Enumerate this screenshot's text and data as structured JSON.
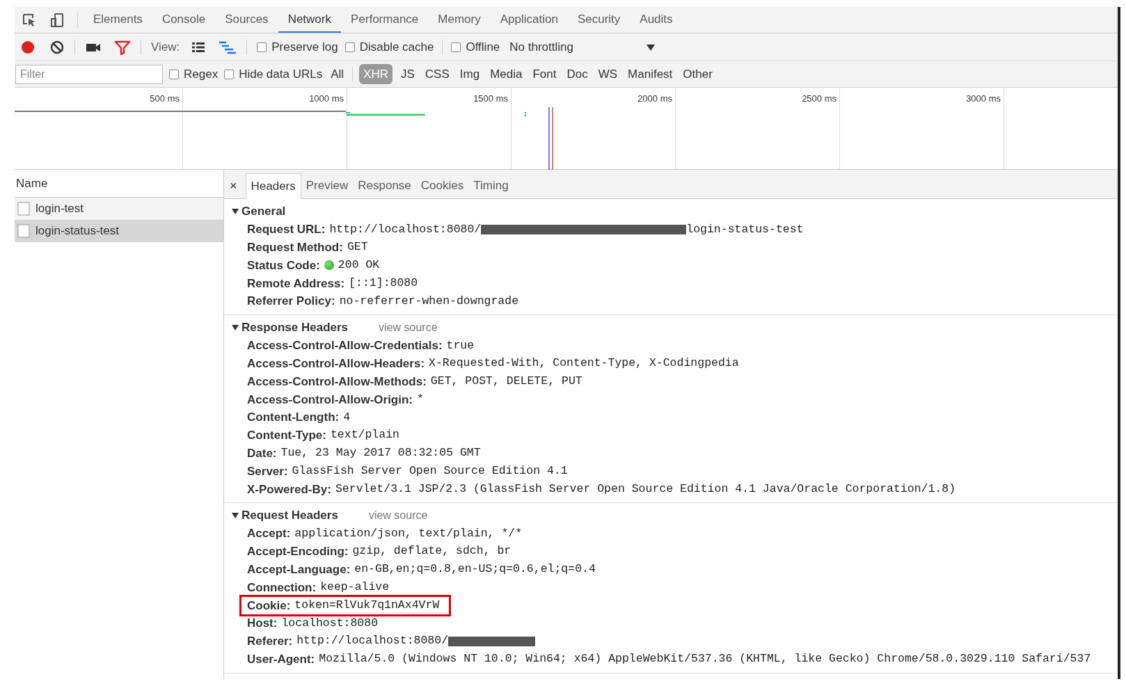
{
  "main_tabs": [
    {
      "label": "Elements",
      "selected": false
    },
    {
      "label": "Console",
      "selected": false
    },
    {
      "label": "Sources",
      "selected": false
    },
    {
      "label": "Network",
      "selected": true
    },
    {
      "label": "Performance",
      "selected": false
    },
    {
      "label": "Memory",
      "selected": false
    },
    {
      "label": "Application",
      "selected": false
    },
    {
      "label": "Security",
      "selected": false
    },
    {
      "label": "Audits",
      "selected": false
    }
  ],
  "toolbar": {
    "recording": true,
    "filter_active": true,
    "view_label": "View:",
    "checkboxes": [
      {
        "label": "Preserve log",
        "checked": false
      },
      {
        "label": "Disable cache",
        "checked": false
      },
      {
        "label": "Offline",
        "checked": false
      }
    ],
    "throttling": "No throttling"
  },
  "filter_bar": {
    "placeholder": "Filter",
    "checkboxes": [
      {
        "label": "Regex",
        "checked": false
      },
      {
        "label": "Hide data URLs",
        "checked": false
      }
    ],
    "types": [
      {
        "label": "All",
        "selected": false
      },
      {
        "label": "XHR",
        "selected": true
      },
      {
        "label": "JS",
        "selected": false
      },
      {
        "label": "CSS",
        "selected": false
      },
      {
        "label": "Img",
        "selected": false
      },
      {
        "label": "Media",
        "selected": false
      },
      {
        "label": "Font",
        "selected": false
      },
      {
        "label": "Doc",
        "selected": false
      },
      {
        "label": "WS",
        "selected": false
      },
      {
        "label": "Manifest",
        "selected": false
      },
      {
        "label": "Other",
        "selected": false
      }
    ]
  },
  "timeline": {
    "ticks": [
      "500 ms",
      "1000 ms",
      "1500 ms",
      "2000 ms",
      "2500 ms",
      "3000 ms"
    ]
  },
  "requests": {
    "column": "Name",
    "items": [
      {
        "name": "login-test",
        "selected": false
      },
      {
        "name": "login-status-test",
        "selected": true
      }
    ]
  },
  "detail_tabs": {
    "close": "×",
    "tabs": [
      {
        "label": "Headers",
        "selected": true
      },
      {
        "label": "Preview",
        "selected": false
      },
      {
        "label": "Response",
        "selected": false
      },
      {
        "label": "Cookies",
        "selected": false
      },
      {
        "label": "Timing",
        "selected": false
      }
    ]
  },
  "sections": [
    {
      "title": "General",
      "expanded": true,
      "rows": [
        {
          "kind": "text",
          "name": "Request URL:",
          "value": "http://localhost:8080/",
          "redacted": true,
          "value_tail": "login-status-test"
        },
        {
          "kind": "text",
          "name": "Request Method:",
          "value": "GET",
          "redacted": false
        },
        {
          "kind": "status",
          "name": "Status Code:",
          "value": "200 OK",
          "redacted": false
        },
        {
          "kind": "text",
          "name": "Remote Address:",
          "value": "[::1]:8080",
          "redacted": false
        },
        {
          "kind": "text",
          "name": "Referrer Policy:",
          "value": "no-referrer-when-downgrade",
          "redacted": false
        }
      ]
    },
    {
      "title": "Response Headers",
      "link": "view source",
      "expanded": true,
      "rows": [
        {
          "kind": "text",
          "name": "Access-Control-Allow-Credentials:",
          "value": "true",
          "redacted": false
        },
        {
          "kind": "text",
          "name": "Access-Control-Allow-Headers:",
          "value": "X-Requested-With, Content-Type, X-Codingpedia",
          "redacted": false
        },
        {
          "kind": "text",
          "name": "Access-Control-Allow-Methods:",
          "value": "GET, POST, DELETE, PUT",
          "redacted": false
        },
        {
          "kind": "text",
          "name": "Access-Control-Allow-Origin:",
          "value": "*",
          "redacted": false
        },
        {
          "kind": "text",
          "name": "Content-Length:",
          "value": "4",
          "redacted": false
        },
        {
          "kind": "text",
          "name": "Content-Type:",
          "value": "text/plain",
          "redacted": false
        },
        {
          "kind": "text",
          "name": "Date:",
          "value": "Tue, 23 May 2017 08:32:05 GMT",
          "redacted": false
        },
        {
          "kind": "text",
          "name": "Server:",
          "value": "GlassFish Server Open Source Edition  4.1",
          "redacted": false
        },
        {
          "kind": "text",
          "name": "X-Powered-By:",
          "value": "Servlet/3.1 JSP/2.3 (GlassFish Server Open Source Edition  4.1  Java/Oracle Corporation/1.8)",
          "redacted": false
        }
      ]
    },
    {
      "title": "Request Headers",
      "link": "view source",
      "expanded": true,
      "rows": [
        {
          "kind": "text",
          "name": "Accept:",
          "value": "application/json, text/plain, */*",
          "redacted": false,
          "highlighted": false
        },
        {
          "kind": "text",
          "name": "Accept-Encoding:",
          "value": "gzip, deflate, sdch, br",
          "redacted": false,
          "highlighted": false
        },
        {
          "kind": "text",
          "name": "Accept-Language:",
          "value": "en-GB,en;q=0.8,en-US;q=0.6,el;q=0.4",
          "redacted": false,
          "highlighted": false
        },
        {
          "kind": "text",
          "name": "Connection:",
          "value": "keep-alive",
          "redacted": false,
          "highlighted": false
        },
        {
          "kind": "text",
          "name": "Cookie:",
          "value": "token=RlVuk7q1nAx4VrW",
          "redacted": false,
          "highlighted": true
        },
        {
          "kind": "text",
          "name": "Host:",
          "value": "localhost:8080",
          "redacted": false,
          "highlighted": false
        },
        {
          "kind": "text",
          "name": "Referer:",
          "value": "http://localhost:8080/",
          "redacted": true,
          "highlighted": false
        },
        {
          "kind": "text",
          "name": "User-Agent:",
          "value": "Mozilla/5.0 (Windows NT 10.0; Win64; x64) AppleWebKit/537.36 (KHTML, like Gecko) Chrome/58.0.3029.110 Safari/537",
          "redacted": false,
          "highlighted": false
        }
      ]
    }
  ]
}
